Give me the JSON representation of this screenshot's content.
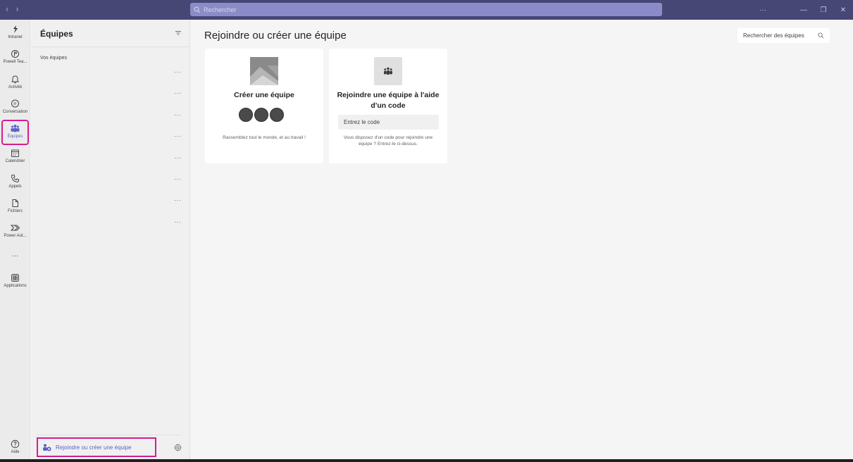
{
  "titlebar": {
    "back_label": "‹",
    "forward_label": "›",
    "search_placeholder": "Rechercher",
    "more_label": "···",
    "minimize_label": "—",
    "maximize_label": "❐",
    "close_label": "✕"
  },
  "rail": {
    "items": [
      {
        "label": "Intranet",
        "icon": "intranet-logo-icon"
      },
      {
        "label": "Powell Tea...",
        "icon": "powell-teams-icon"
      },
      {
        "label": "Activité",
        "icon": "bell-icon"
      },
      {
        "label": "Conversation",
        "icon": "chat-icon"
      },
      {
        "label": "Équipes",
        "icon": "teams-icon",
        "active": true
      },
      {
        "label": "Calendrier",
        "icon": "calendar-icon"
      },
      {
        "label": "Appels",
        "icon": "phone-icon"
      },
      {
        "label": "Fichiers",
        "icon": "file-icon"
      },
      {
        "label": "Power Aut...",
        "icon": "power-automate-icon"
      },
      {
        "label": "···",
        "icon": "more-apps-icon"
      },
      {
        "label": "Applications",
        "icon": "apps-icon"
      },
      {
        "label": "Aide",
        "icon": "help-icon"
      }
    ]
  },
  "panel": {
    "title": "Équipes",
    "section_label": "Vos équipes",
    "row_more": "···",
    "join_button_label": "Rejoindre ou créer une équipe"
  },
  "main": {
    "title": "Rejoindre ou créer une équipe",
    "search_placeholder": "Rechercher des équipes",
    "create_card": {
      "title": "Créer une équipe",
      "description": "Rassemblez tout le monde, et au travail !"
    },
    "join_card": {
      "title": "Rejoindre une équipe à l'aide d'un code",
      "input_placeholder": "Entrez le code",
      "description": "Vous disposez d'un code pour rejoindre une équipe ? Entrez-le ci-dessus."
    }
  },
  "colors": {
    "titlebar": "#464775",
    "accent": "#5b5fc7",
    "highlight": "#d41e8e"
  }
}
